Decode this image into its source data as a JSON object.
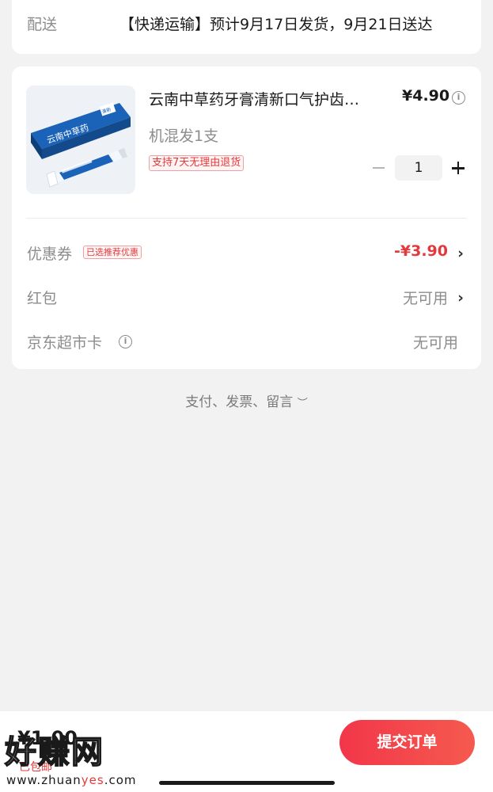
{
  "delivery": {
    "label": "配送",
    "text": "【快递运输】预计9月17日发货，9月21日送达"
  },
  "product": {
    "title": "云南中草药牙膏清新口气护齿…",
    "price": "¥4.90",
    "spec": "机混发1支",
    "tag": "支持7天无理由退货",
    "quantity": "1",
    "image_brand": "云南中草药",
    "image_badge": "清新"
  },
  "rows": [
    {
      "label": "优惠券",
      "tag": "已选推荐优惠",
      "value": "-¥3.90",
      "has_arrow": true
    },
    {
      "label": "红包",
      "value": "无可用",
      "has_arrow": true
    },
    {
      "label": "京东超市卡",
      "value": "无可用",
      "has_arrow": false
    }
  ],
  "more": {
    "label": "支付、发票、留言",
    "icon": "chevron-down-icon"
  },
  "footer": {
    "total": "¥1.00",
    "shipping": "已包邮",
    "submit_label": "提交订单"
  },
  "watermark": {
    "text": "好赚网",
    "url_prefix": "www.zhuan",
    "url_highlight": "yes",
    "url_suffix": ".com"
  },
  "colors": {
    "accent": "#e4393c",
    "button_gradient_start": "#f2364a",
    "button_gradient_end": "#f55a4e",
    "background": "#f2f2f2"
  }
}
